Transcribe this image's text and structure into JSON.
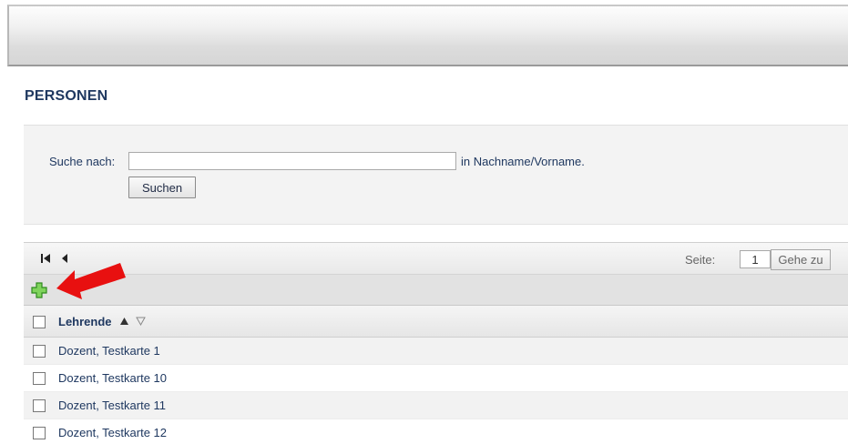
{
  "header": {
    "title": "PERSONEN"
  },
  "search": {
    "label": "Suche nach:",
    "value": "",
    "placeholder": "",
    "hint": "in Nachname/Vorname.",
    "button_label": "Suchen"
  },
  "pager": {
    "page_label": "Seite:",
    "page_value": "1",
    "goto_label": "Gehe zu"
  },
  "table": {
    "column_label": "Lehrende",
    "rows": [
      {
        "name": "Dozent, Testkarte 1"
      },
      {
        "name": "Dozent, Testkarte 10"
      },
      {
        "name": "Dozent, Testkarte 11"
      },
      {
        "name": "Dozent, Testkarte 12"
      }
    ]
  },
  "icons": {
    "first_page": "first-page-icon",
    "prev_page": "prev-page-icon",
    "add": "add-icon",
    "sort_asc": "sort-asc-icon",
    "sort_desc": "sort-desc-icon",
    "annotation": "red-arrow-annotation"
  },
  "colors": {
    "title": "#1f3860",
    "add_icon": "#49a833",
    "annotation_arrow": "#e81010"
  }
}
